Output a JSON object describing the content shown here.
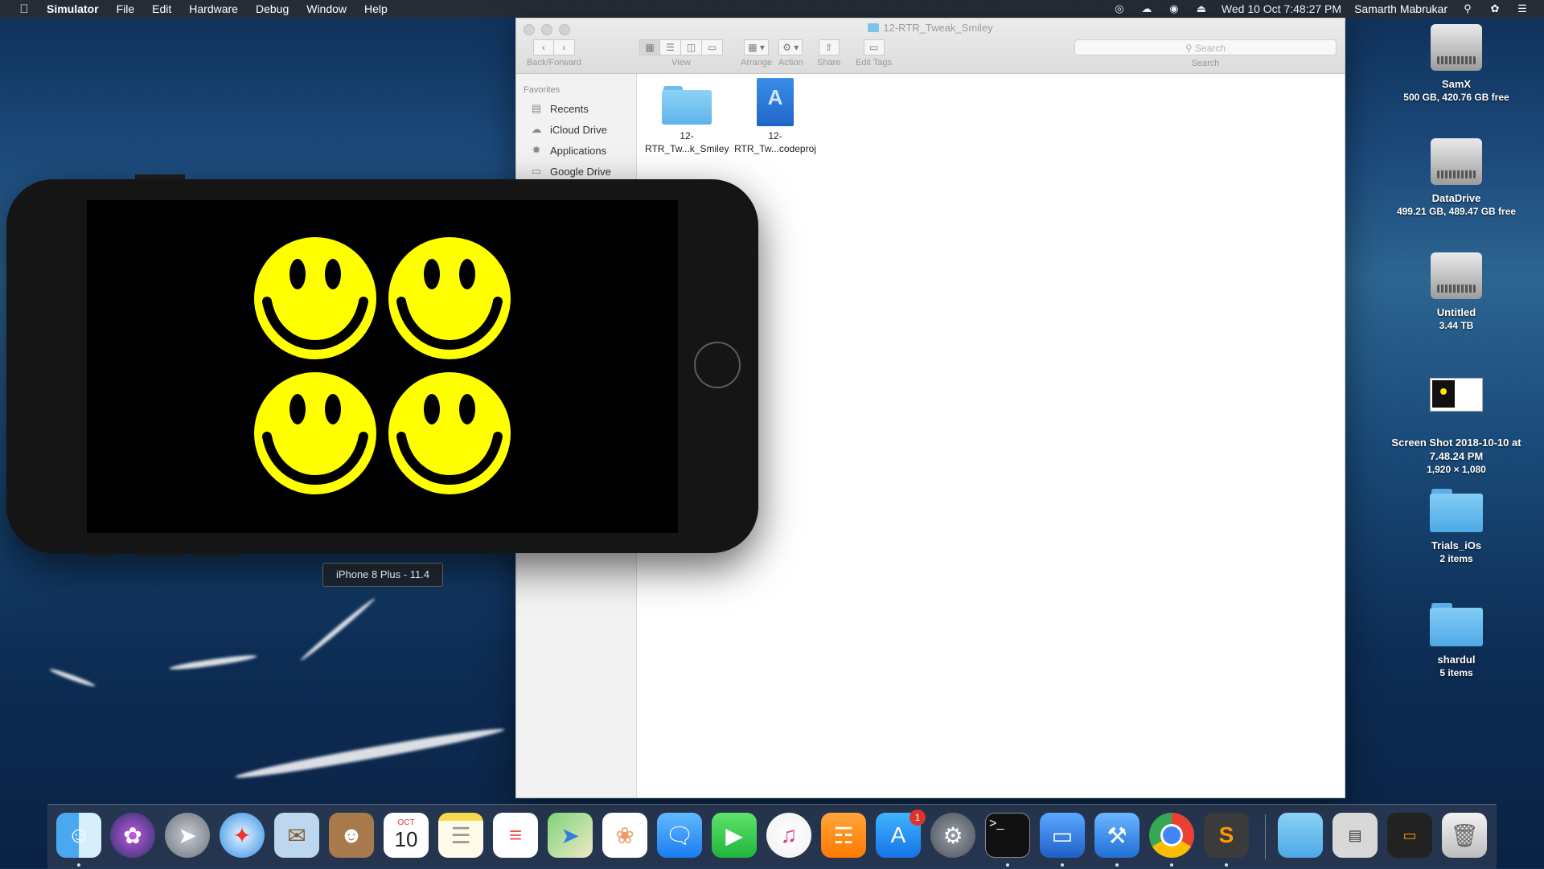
{
  "menubar": {
    "app_name": "Simulator",
    "items": [
      "File",
      "Edit",
      "Hardware",
      "Debug",
      "Window",
      "Help"
    ],
    "datetime": "Wed 10 Oct  7:48:27 PM",
    "user": "Samarth Mabrukar"
  },
  "finder": {
    "title": "12-RTR_Tweak_Smiley",
    "toolbar": {
      "back_forward_label": "Back/Forward",
      "view_label": "View",
      "arrange_label": "Arrange",
      "action_label": "Action",
      "share_label": "Share",
      "edit_tags_label": "Edit Tags",
      "search_placeholder": "Search",
      "search_label": "Search"
    },
    "sidebar": {
      "heading": "Favorites",
      "items": [
        {
          "label": "Recents",
          "icon": "recents-icon"
        },
        {
          "label": "iCloud Drive",
          "icon": "cloud-icon"
        },
        {
          "label": "Applications",
          "icon": "applications-icon"
        },
        {
          "label": "Google Drive",
          "icon": "folder-icon"
        }
      ]
    },
    "files": [
      {
        "line1": "12-",
        "line2": "RTR_Tw...k_Smiley",
        "icon": "folder-icon"
      },
      {
        "line1": "12-",
        "line2": "RTR_Tw...codeproj",
        "icon": "xcodeproj-icon"
      }
    ]
  },
  "simulator": {
    "device_label": "iPhone 8 Plus - 11.4",
    "smiley_color": "#ffff00"
  },
  "desktop": {
    "icons": [
      {
        "name": "SamX",
        "sub": "500 GB, 420.76 GB free",
        "icon": "hard-drive-icon"
      },
      {
        "name": "DataDrive",
        "sub": "499.21 GB, 489.47 GB free",
        "icon": "hard-drive-icon"
      },
      {
        "name": "Untitled",
        "sub": "3.44 TB",
        "icon": "hard-drive-icon"
      },
      {
        "name": "Screen Shot 2018-10-10 at 7.48.24 PM",
        "sub": "1,920 × 1,080",
        "icon": "screenshot-thumbnail-icon"
      },
      {
        "name": "Trials_iOs",
        "sub": "2 items",
        "icon": "folder-icon"
      },
      {
        "name": "shardul",
        "sub": "5 items",
        "icon": "folder-icon"
      }
    ]
  },
  "dock": {
    "calendar_month": "OCT",
    "calendar_day": "10",
    "appstore_badge": "1",
    "terminal_prompt": ">_"
  }
}
